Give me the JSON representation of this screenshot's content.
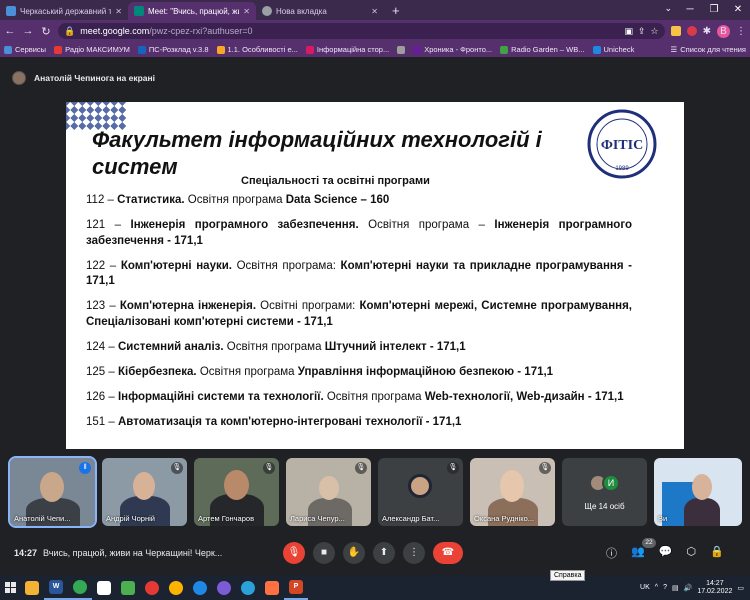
{
  "browser": {
    "tabs": [
      {
        "title": "Черкаський державний технол",
        "color": "#4a8fd8",
        "active": false
      },
      {
        "title": "Meet: \"Вчись, працюй, живи",
        "color": "#00897b",
        "active": true
      },
      {
        "title": "Нова вкладка",
        "color": "#9aa0a6",
        "active": false
      }
    ],
    "new_tab_label": "+",
    "url_host": "meet.google.com",
    "url_path": "/pwz-cpez-rxi?authuser=0",
    "profile_letter": "B",
    "bookmarks": [
      {
        "label": "Сервисы",
        "color": "#4a8fd8"
      },
      {
        "label": "Радіо МАКСИМУМ",
        "color": "#e53935"
      },
      {
        "label": "ПС-Розклад v.3.8",
        "color": "#1565c0"
      },
      {
        "label": "1.1. Особливості е...",
        "color": "#f9a825"
      },
      {
        "label": "Інформаційна стор...",
        "color": "#d81b60"
      },
      {
        "label": "",
        "color": "#9e9e9e"
      },
      {
        "label": "Хроника - Фронто...",
        "color": "#6a1b9a"
      },
      {
        "label": "Radio Garden – WB...",
        "color": "#43a047"
      },
      {
        "label": "Unicheck",
        "color": "#1e88e5"
      }
    ],
    "reading_list": "Список для чтения"
  },
  "meet": {
    "presenter_label": "Анатолій Чепинога на екрані",
    "slide": {
      "title": "Факультет інформаційних технологій і систем",
      "subtitle": "Спеціальності та освітні програми",
      "items": [
        {
          "code": "112 – ",
          "spec": "Статистика.",
          "mid": " Освітня програма ",
          "prog": "Data Science – 160"
        },
        {
          "code": "121 – ",
          "spec": "Інженерія програмного забезпечення.",
          "mid": " Освітня програма – ",
          "prog": "Інженерія програмного забезпечення - 171,1"
        },
        {
          "code": "122 – ",
          "spec": "Комп'ютерні науки.",
          "mid": " Освітня програма: ",
          "prog": "Комп'ютерні науки та прикладне програмування - 171,1"
        },
        {
          "code": "123 – ",
          "spec": "Комп'ютерна інженерія.",
          "mid": " Освітні програми: ",
          "prog": "Комп'ютерні мережі, Системне програмування, Спеціалізовані комп'ютерні системи - 171,1"
        },
        {
          "code": "124 – ",
          "spec": "Системний аналіз.",
          "mid": " Освітня програма ",
          "prog": "Штучний інтелект - 171,1"
        },
        {
          "code": "125 – ",
          "spec": "Кібербезпека.",
          "mid": " Освітня програма ",
          "prog": "Управління інформаційною безпекою - 171,1"
        },
        {
          "code": "126 – ",
          "spec": "Інформаційні системи та технології.",
          "mid": " Освітня програма ",
          "prog": "Web-технології, Web-дизайн - 171,1"
        },
        {
          "code": "151 – ",
          "spec": "Автоматизація та комп'ютерно-інтегровані технології - 171,1",
          "mid": "",
          "prog": ""
        }
      ],
      "logo_text": "ФІТІС",
      "logo_year": "1989"
    },
    "participants": [
      {
        "name": "Анатолій Чепи...",
        "bg": "#7a8794",
        "head": "#c9a78a",
        "body": "#3b3f46",
        "speaking": true
      },
      {
        "name": "Андрій Чорній",
        "bg": "#8c9aa6",
        "head": "#d7b296",
        "body": "#2f3a52",
        "speaking": false
      },
      {
        "name": "Артем Гончаров",
        "bg": "#5d6b58",
        "head": "#b88a6a",
        "body": "#25272b",
        "speaking": false
      },
      {
        "name": "Лариса Чепур...",
        "bg": "#b8b2a6",
        "head": "#d8c0a8",
        "body": "#6d6a66",
        "speaking": false
      },
      {
        "name": "Александр Бат...",
        "bg": "#3c4043",
        "head": "#caa284",
        "body": "#1f2633",
        "speaking": false
      },
      {
        "name": "Оксана Рудніко...",
        "bg": "#c9bfb5",
        "head": "#e6c6ad",
        "body": "#8b6f5a",
        "speaking": false
      }
    ],
    "more_label": "Ще 14 осіб",
    "more_letter": "И",
    "self_label": "Ви",
    "meeting_time": "14:27",
    "meeting_title": "Вчись, працюй, живи на Черкащині! Черк...",
    "people_count": "22"
  },
  "taskbar": {
    "lang": "UK",
    "time": "14:27",
    "date": "17.02.2022",
    "tooltip": "Справка",
    "apps": [
      {
        "label": "",
        "color": "#f2b233"
      },
      {
        "label": "W",
        "color": "#2b579a"
      },
      {
        "label": "",
        "color": "#34a853"
      },
      {
        "label": "",
        "color": "#ffffff"
      },
      {
        "label": "",
        "color": "#4caf50"
      },
      {
        "label": "",
        "color": "#e53935"
      },
      {
        "label": "",
        "color": "#ffb300"
      },
      {
        "label": "",
        "color": "#1e88e5"
      },
      {
        "label": "",
        "color": "#7b5bd6"
      },
      {
        "label": "",
        "color": "#2aa1d8"
      },
      {
        "label": "",
        "color": "#ff7043"
      },
      {
        "label": "P",
        "color": "#d24726"
      }
    ]
  }
}
